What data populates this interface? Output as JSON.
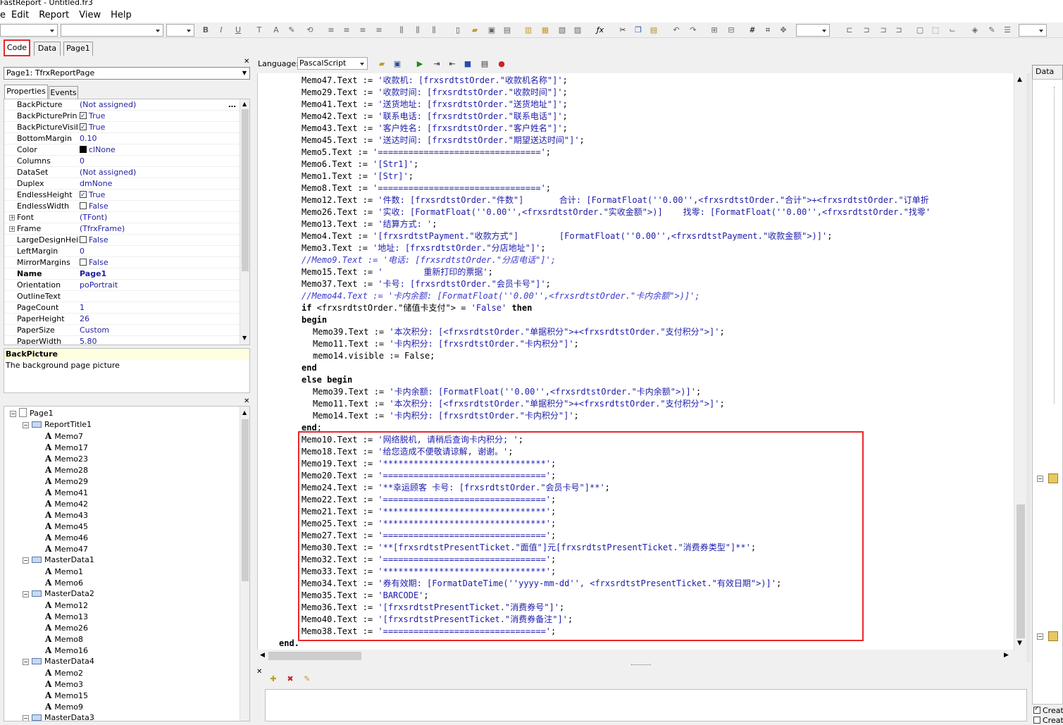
{
  "window": {
    "title": "FastReport - Untitled.fr3"
  },
  "menu": [
    "File",
    "Edit",
    "Report",
    "View",
    "Help"
  ],
  "menu_display": [
    "e",
    "Edit",
    "Report",
    "View",
    "Help"
  ],
  "tabs": [
    "Code",
    "Data",
    "Page1"
  ],
  "code_toolbar": {
    "language_label": "Language:",
    "language_value": "PascalScript"
  },
  "object_selector": "Page1: TfrxReportPage",
  "inspector_tabs": [
    "Properties",
    "Events"
  ],
  "properties": [
    {
      "name": "BackPicture",
      "value": "(Not assigned)",
      "kind": "ellipsis"
    },
    {
      "name": "BackPicturePrintab",
      "value": "True",
      "kind": "check-on"
    },
    {
      "name": "BackPictureVisible",
      "value": "True",
      "kind": "check-on"
    },
    {
      "name": "BottomMargin",
      "value": "0.10"
    },
    {
      "name": "Color",
      "value": "clNone",
      "kind": "swatch"
    },
    {
      "name": "Columns",
      "value": "0"
    },
    {
      "name": "DataSet",
      "value": "(Not assigned)"
    },
    {
      "name": "Duplex",
      "value": "dmNone"
    },
    {
      "name": "EndlessHeight",
      "value": "True",
      "kind": "check-on"
    },
    {
      "name": "EndlessWidth",
      "value": "False",
      "kind": "check-off"
    },
    {
      "name": "Font",
      "value": "(TFont)",
      "kind": "expand"
    },
    {
      "name": "Frame",
      "value": "(TfrxFrame)",
      "kind": "expand"
    },
    {
      "name": "LargeDesignHeigh",
      "value": "False",
      "kind": "check-off"
    },
    {
      "name": "LeftMargin",
      "value": "0"
    },
    {
      "name": "MirrorMargins",
      "value": "False",
      "kind": "check-off"
    },
    {
      "name": "Name",
      "value": "Page1",
      "kind": "bold"
    },
    {
      "name": "Orientation",
      "value": "poPortrait"
    },
    {
      "name": "OutlineText",
      "value": ""
    },
    {
      "name": "PageCount",
      "value": "1"
    },
    {
      "name": "PaperHeight",
      "value": "26"
    },
    {
      "name": "PaperSize",
      "value": "Custom"
    },
    {
      "name": "PaperWidth",
      "value": "5.80"
    }
  ],
  "description": {
    "title": "BackPicture",
    "text": "The background page picture"
  },
  "tree": [
    {
      "label": "Page1",
      "type": "page",
      "level": 0
    },
    {
      "label": "ReportTitle1",
      "type": "band",
      "level": 1
    },
    {
      "label": "Memo7",
      "type": "memo",
      "level": 2
    },
    {
      "label": "Memo17",
      "type": "memo",
      "level": 2
    },
    {
      "label": "Memo23",
      "type": "memo",
      "level": 2
    },
    {
      "label": "Memo28",
      "type": "memo",
      "level": 2
    },
    {
      "label": "Memo29",
      "type": "memo",
      "level": 2
    },
    {
      "label": "Memo41",
      "type": "memo",
      "level": 2
    },
    {
      "label": "Memo42",
      "type": "memo",
      "level": 2
    },
    {
      "label": "Memo43",
      "type": "memo",
      "level": 2
    },
    {
      "label": "Memo45",
      "type": "memo",
      "level": 2
    },
    {
      "label": "Memo46",
      "type": "memo",
      "level": 2
    },
    {
      "label": "Memo47",
      "type": "memo",
      "level": 2
    },
    {
      "label": "MasterData1",
      "type": "band",
      "level": 1
    },
    {
      "label": "Memo1",
      "type": "memo",
      "level": 2
    },
    {
      "label": "Memo6",
      "type": "memo",
      "level": 2
    },
    {
      "label": "MasterData2",
      "type": "band",
      "level": 1
    },
    {
      "label": "Memo12",
      "type": "memo",
      "level": 2
    },
    {
      "label": "Memo13",
      "type": "memo",
      "level": 2
    },
    {
      "label": "Memo26",
      "type": "memo",
      "level": 2
    },
    {
      "label": "Memo8",
      "type": "memo",
      "level": 2
    },
    {
      "label": "Memo16",
      "type": "memo",
      "level": 2
    },
    {
      "label": "MasterData4",
      "type": "band",
      "level": 1
    },
    {
      "label": "Memo2",
      "type": "memo",
      "level": 2
    },
    {
      "label": "Memo3",
      "type": "memo",
      "level": 2
    },
    {
      "label": "Memo15",
      "type": "memo",
      "level": 2
    },
    {
      "label": "Memo9",
      "type": "memo",
      "level": 2
    },
    {
      "label": "MasterData3",
      "type": "band",
      "level": 1
    }
  ],
  "code_lines": [
    {
      "indent": 0,
      "prefix": "Memo47.Text := ",
      "str": "'收款机: [frxsrdtstOrder.\"收款机名称\"]'",
      "suffix": ";"
    },
    {
      "indent": 0,
      "prefix": "Memo29.Text := ",
      "str": "'收款时间: [frxsrdtstOrder.\"收款时间\"]'",
      "suffix": ";"
    },
    {
      "indent": 0,
      "prefix": "Memo41.Text := ",
      "str": "'送货地址: [frxsrdtstOrder.\"送货地址\"]'",
      "suffix": ";"
    },
    {
      "indent": 0,
      "prefix": "Memo42.Text := ",
      "str": "'联系电话: [frxsrdtstOrder.\"联系电话\"]'",
      "suffix": ";"
    },
    {
      "indent": 0,
      "prefix": "Memo43.Text := ",
      "str": "'客户姓名: [frxsrdtstOrder.\"客户姓名\"]'",
      "suffix": ";"
    },
    {
      "indent": 0,
      "prefix": "Memo45.Text := ",
      "str": "'送达时间: [frxsrdtstOrder.\"期望送达时间\"]'",
      "suffix": ";"
    },
    {
      "indent": 0,
      "prefix": "Memo5.Text := ",
      "str": "'================================'",
      "suffix": ";"
    },
    {
      "indent": 0,
      "prefix": "Memo6.Text := ",
      "str": "'[Str1]'",
      "suffix": ";"
    },
    {
      "indent": 0,
      "prefix": "Memo1.Text := ",
      "str": "'[Str]'",
      "suffix": ";"
    },
    {
      "indent": 0,
      "prefix": "Memo8.Text := ",
      "str": "'================================'",
      "suffix": ";"
    },
    {
      "indent": 0,
      "prefix": "Memo12.Text := ",
      "str": "'件数: [frxsrdtstOrder.\"件数\"]       合计: [FormatFloat(''0.00'',<frxsrdtstOrder.\"合计\">+<frxsrdtstOrder.\"订单折",
      "suffix": ""
    },
    {
      "indent": 0,
      "prefix": "Memo26.Text := ",
      "str": "'实收: [FormatFloat(''0.00'',<frxsrdtstOrder.\"实收金额\">)]    找零: [FormatFloat(''0.00'',<frxsrdtstOrder.\"找零'",
      "suffix": ""
    },
    {
      "indent": 0,
      "prefix": "Memo13.Text := ",
      "str": "'结算方式: '",
      "suffix": ";"
    },
    {
      "indent": 0,
      "prefix": "Memo4.Text := ",
      "str": "'[frxsrdtstPayment.\"收款方式\"]        [FormatFloat(''0.00'',<frxsrdtstPayment.\"收款金额\">)]'",
      "suffix": ";"
    },
    {
      "indent": 0,
      "prefix": "Memo3.Text := ",
      "str": "'地址: [frxsrdtstOrder.\"分店地址\"]'",
      "suffix": ";"
    },
    {
      "indent": 0,
      "comment": "//Memo9.Text := '电话: [frxsrdtstOrder.\"分店电话\"]';"
    },
    {
      "indent": 0,
      "prefix": "Memo15.Text := ",
      "str": "'        重新打印的票据'",
      "suffix": ";"
    },
    {
      "indent": 0,
      "prefix": "Memo37.Text := ",
      "str": "'卡号: [frxsrdtstOrder.\"会员卡号\"]'",
      "suffix": ";"
    },
    {
      "indent": 0,
      "comment": "//Memo44.Text := '卡内余额: [FormatFloat(''0.00'',<frxsrdtstOrder.\"卡内余额\">)]';"
    },
    {
      "indent": 0,
      "kw": "if",
      "prefix": " <frxsrdtstOrder.\"储值卡支付\"> = ",
      "str": "'False'",
      "suffix": " ",
      "kw2": "then"
    },
    {
      "indent": 0,
      "kw": "begin"
    },
    {
      "indent": 1,
      "prefix": "Memo39.Text := ",
      "str": "'本次积分: [<frxsrdtstOrder.\"单据积分\">+<frxsrdtstOrder.\"支付积分\">]'",
      "suffix": ";"
    },
    {
      "indent": 1,
      "prefix": "Memo11.Text := ",
      "str": "'卡内积分: [frxsrdtstOrder.\"卡内积分\"]'",
      "suffix": ";"
    },
    {
      "indent": 1,
      "prefix": "memo14.visible := False;"
    },
    {
      "indent": 0,
      "kw": "end"
    },
    {
      "indent": 0,
      "kw": "else begin"
    },
    {
      "indent": 1,
      "prefix": "Memo39.Text := ",
      "str": "'卡内余额: [FormatFloat(''0.00'',<frxsrdtstOrder.\"卡内余额\">)]'",
      "suffix": ";"
    },
    {
      "indent": 1,
      "prefix": "Memo11.Text := ",
      "str": "'本次积分: [<frxsrdtstOrder.\"单据积分\">+<frxsrdtstOrder.\"支付积分\">]'",
      "suffix": ";"
    },
    {
      "indent": 1,
      "prefix": "Memo14.Text := ",
      "str": "'卡内积分: [frxsrdtstOrder.\"卡内积分\"]'",
      "suffix": ";"
    },
    {
      "indent": 0,
      "kw": "end",
      "suffix": ";"
    },
    {
      "indent": 0,
      "prefix": "Memo10.Text := ",
      "str": "'网络脱机, 请稍后查询卡内积分; '",
      "suffix": ";"
    },
    {
      "indent": 0,
      "prefix": "Memo18.Text := ",
      "str": "'给您造成不便敬请谅解, 谢谢。'",
      "suffix": ";"
    },
    {
      "indent": 0,
      "prefix": "Memo19.Text := ",
      "str": "'********************************'",
      "suffix": ";"
    },
    {
      "indent": 0,
      "prefix": "Memo20.Text := ",
      "str": "'================================'",
      "suffix": ";"
    },
    {
      "indent": 0,
      "prefix": "Memo24.Text := ",
      "str": "'**幸运顾客 卡号: [frxsrdtstOrder.\"会员卡号\"]**'",
      "suffix": ";"
    },
    {
      "indent": 0,
      "prefix": "Memo22.Text := ",
      "str": "'================================'",
      "suffix": ";"
    },
    {
      "indent": 0,
      "prefix": "Memo21.Text := ",
      "str": "'********************************'",
      "suffix": ";"
    },
    {
      "indent": 0,
      "prefix": "Memo25.Text := ",
      "str": "'********************************'",
      "suffix": ";"
    },
    {
      "indent": 0,
      "prefix": "Memo27.Text := ",
      "str": "'================================'",
      "suffix": ";"
    },
    {
      "indent": 0,
      "prefix": "Memo30.Text := ",
      "str": "'**[frxsrdtstPresentTicket.\"面值\"]元[frxsrdtstPresentTicket.\"消费券类型\"]**'",
      "suffix": ";"
    },
    {
      "indent": 0,
      "prefix": "Memo32.Text := ",
      "str": "'================================'",
      "suffix": ";"
    },
    {
      "indent": 0,
      "prefix": "Memo33.Text := ",
      "str": "'********************************'",
      "suffix": ";"
    },
    {
      "indent": 0,
      "prefix": "Memo34.Text := ",
      "str": "'券有效期: [FormatDateTime(''yyyy-mm-dd'', <frxsrdtstPresentTicket.\"有效日期\">)]'",
      "suffix": ";"
    },
    {
      "indent": 0,
      "prefix": "Memo35.Text := ",
      "str": "'BARCODE'",
      "suffix": ";"
    },
    {
      "indent": 0,
      "prefix": "Memo36.Text := ",
      "str": "'[frxsrdtstPresentTicket.\"消费券号\"]'",
      "suffix": ";"
    },
    {
      "indent": 0,
      "prefix": "Memo40.Text := ",
      "str": "'[frxsrdtstPresentTicket.\"消费券备注\"]'",
      "suffix": ";"
    },
    {
      "indent": 0,
      "prefix": "Memo38.Text := ",
      "str": "'================================'",
      "suffix": ";"
    },
    {
      "indent": -2,
      "kw": "end."
    }
  ],
  "right_panel": {
    "title": "Data",
    "items": [
      "Creat",
      "Creat"
    ]
  },
  "colors": {
    "highlight": "#e8272d",
    "string": "#1c1caa"
  }
}
